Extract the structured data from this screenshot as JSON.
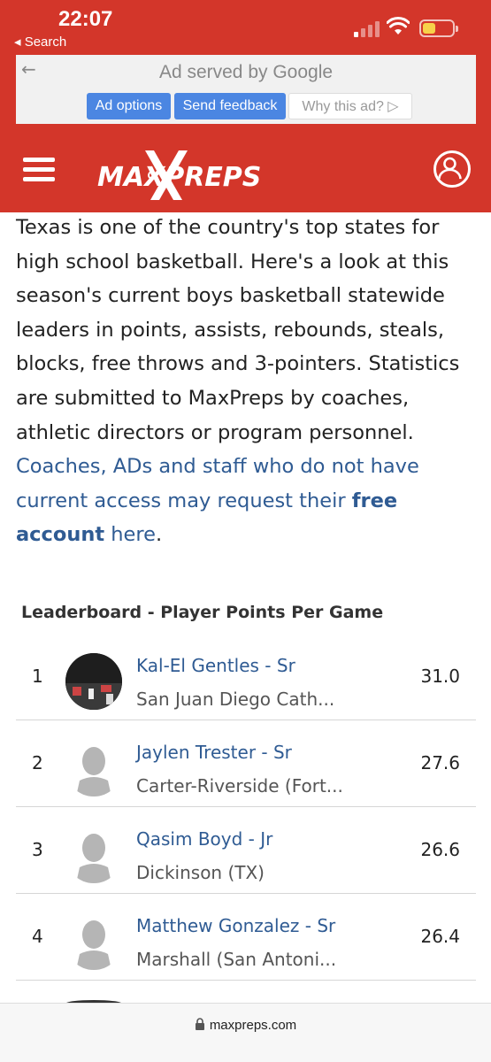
{
  "status_bar": {
    "time": "22:07",
    "back_label": "◂ Search",
    "battery_color": "#f7d14a"
  },
  "ad": {
    "title": "Ad served by Google",
    "back_icon": "back-arrow-icon",
    "buttons": [
      "Ad options",
      "Send feedback",
      "Why this ad? ▷"
    ]
  },
  "header": {
    "brand": "MAXPREPS",
    "brand_color": "#d3362a",
    "menu_icon": "hamburger-icon",
    "account_icon": "user-icon"
  },
  "intro": {
    "text": "Texas is one of the country's top states for high school basketball. Here's a look at this season's current boys basketball statewide leaders in points, assists, rebounds, steals, blocks, free throws and 3-pointers. Statistics are submitted to MaxPreps by coaches, athletic directors or program personnel. ",
    "link_text_1": "Coaches, ADs and staff who do not have current access may request their ",
    "link_bold": "free account",
    "link_text_2": " here",
    "end": "."
  },
  "leaderboard": {
    "title": "Leaderboard - Player Points Per Game",
    "rows": [
      {
        "rank": "1",
        "name": "Kal-El Gentles - Sr",
        "school": "San Juan Diego Cath...",
        "value": "31.0",
        "photo": "player-photo"
      },
      {
        "rank": "2",
        "name": "Jaylen Trester - Sr",
        "school": "Carter-Riverside (Fort...",
        "value": "27.6",
        "photo": "placeholder-silhouette"
      },
      {
        "rank": "3",
        "name": "Qasim Boyd - Jr",
        "school": "Dickinson (TX)",
        "value": "26.6",
        "photo": "placeholder-silhouette"
      },
      {
        "rank": "4",
        "name": "Matthew Gonzalez - Sr",
        "school": "Marshall (San Antoni...",
        "value": "26.4",
        "photo": "placeholder-silhouette"
      }
    ]
  },
  "browser": {
    "url": "maxpreps.com",
    "lock_icon": "lock-icon"
  }
}
